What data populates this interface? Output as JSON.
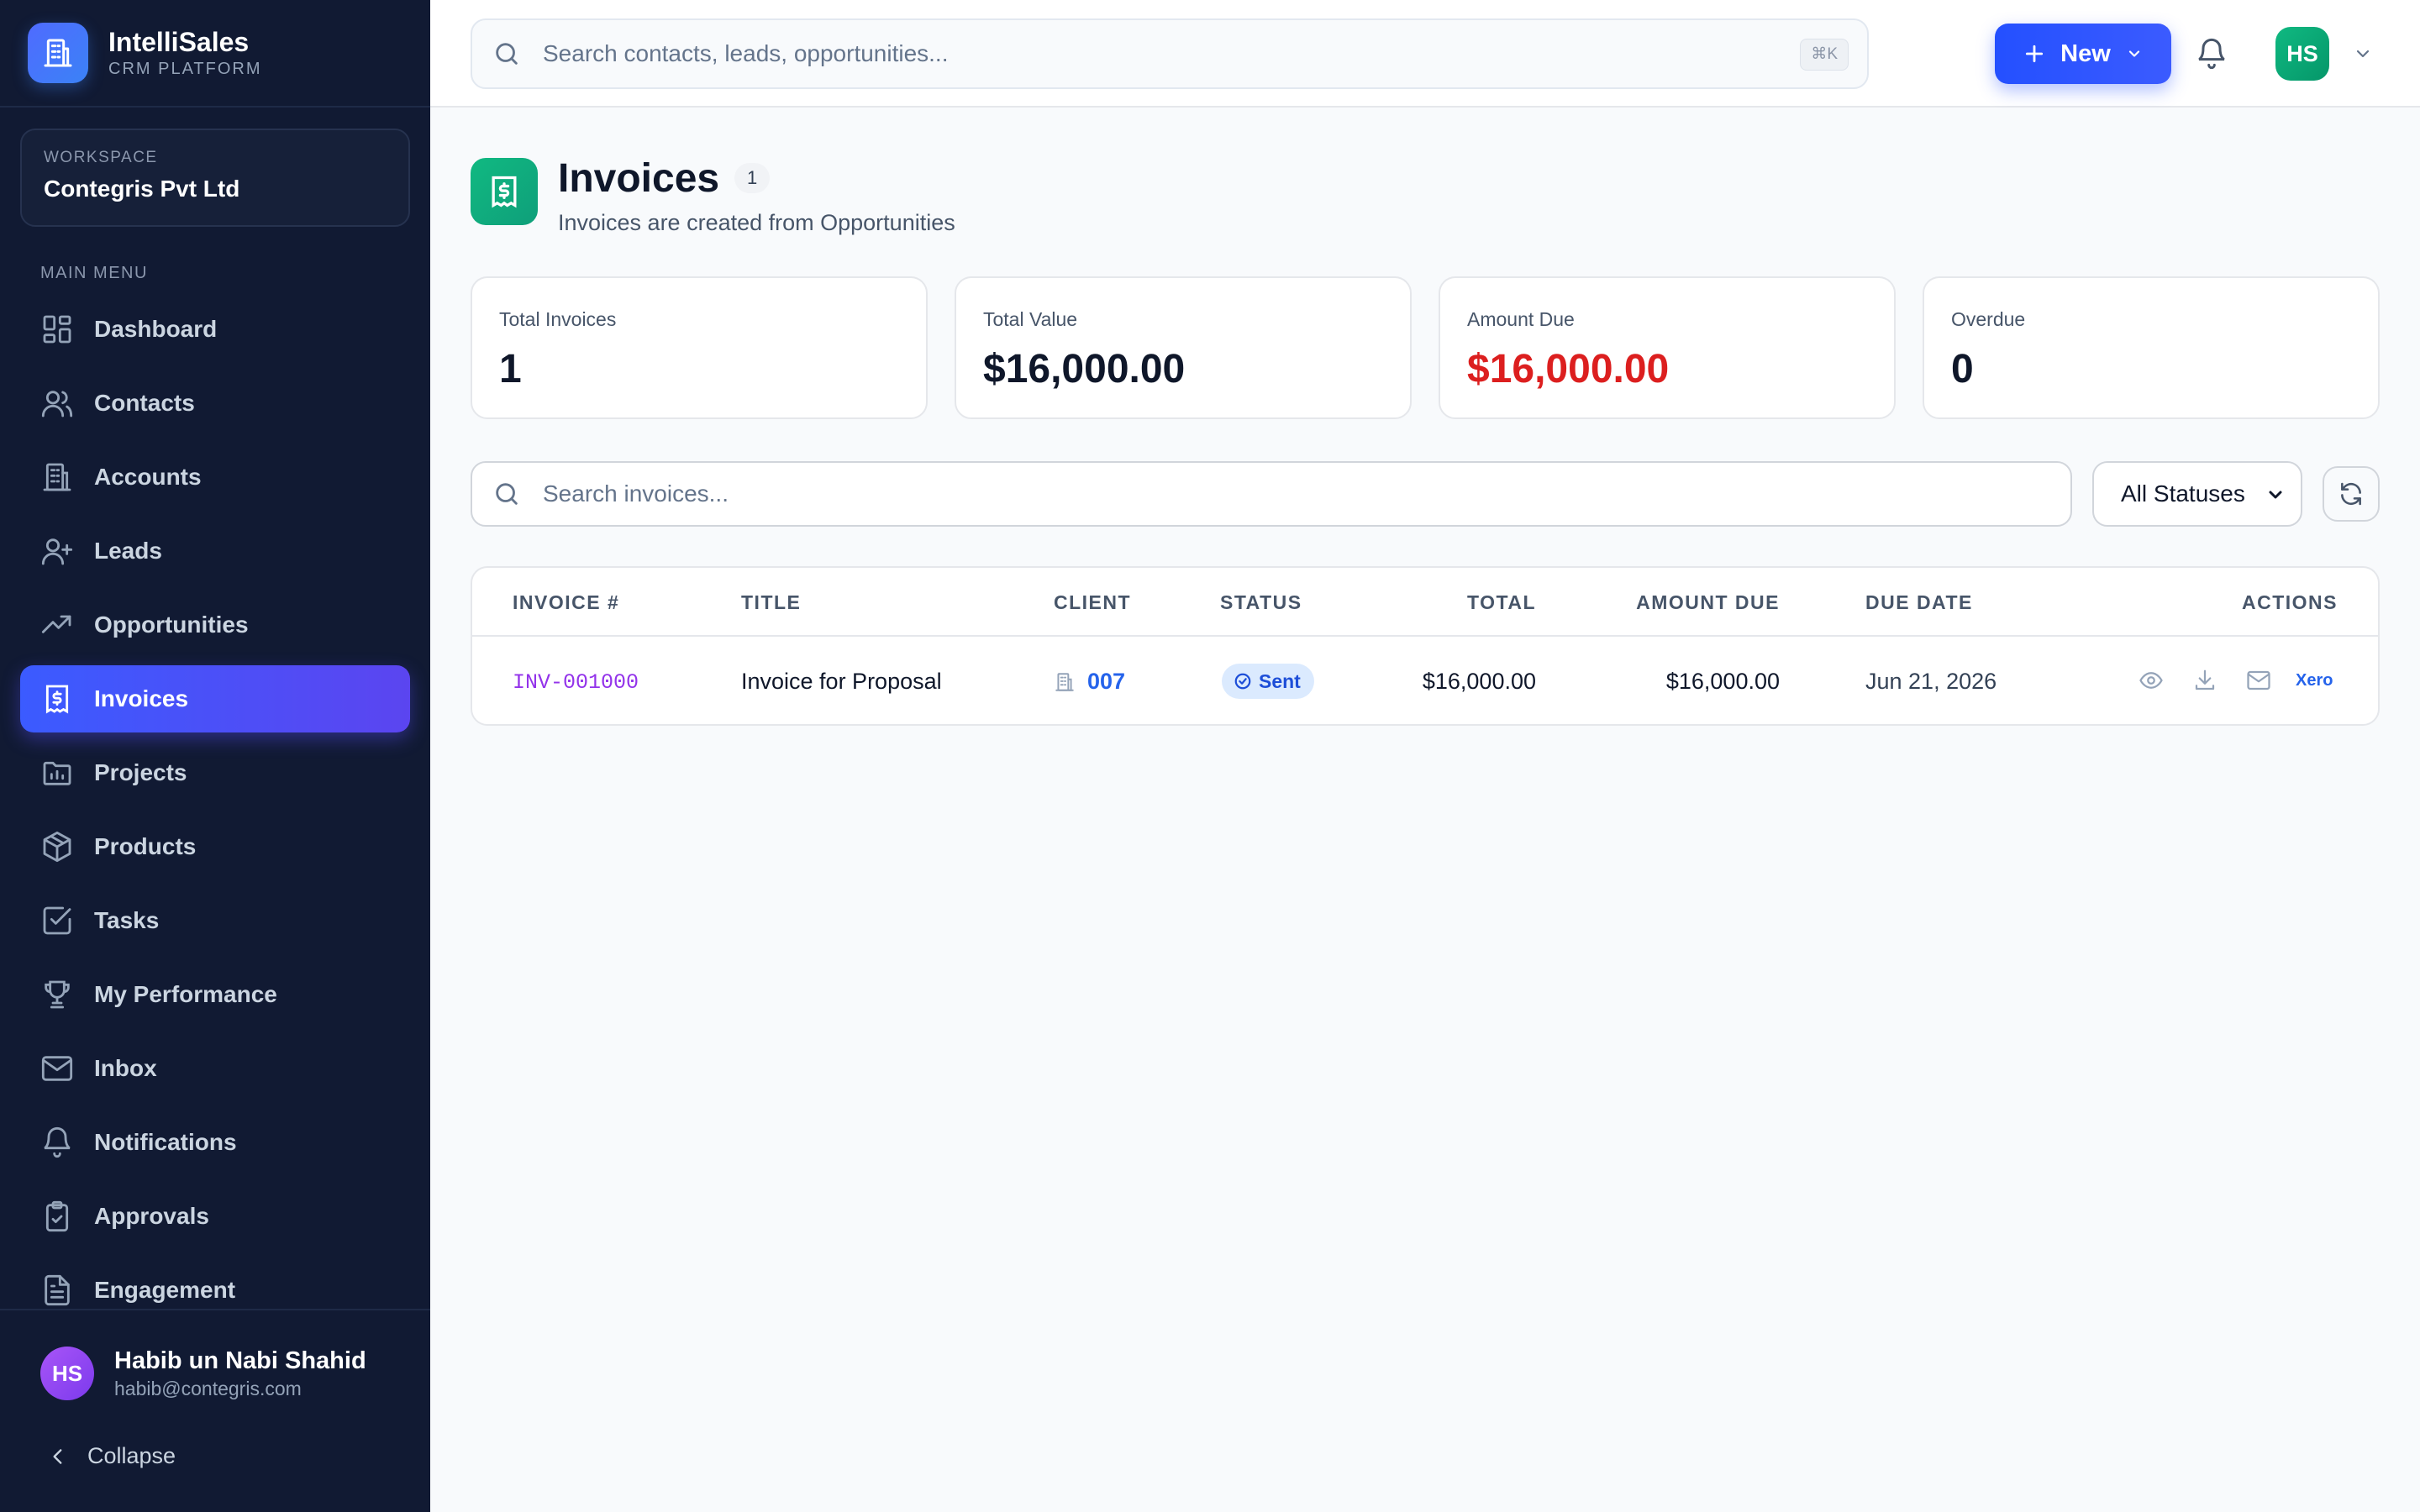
{
  "brand": {
    "name": "IntelliSales",
    "subtitle": "CRM PLATFORM"
  },
  "workspace": {
    "label": "WORKSPACE",
    "name": "Contegris Pvt Ltd"
  },
  "sidebar": {
    "menu_label": "MAIN MENU",
    "items": [
      {
        "label": "Dashboard",
        "icon": "dashboard-icon"
      },
      {
        "label": "Contacts",
        "icon": "users-icon"
      },
      {
        "label": "Accounts",
        "icon": "building-icon"
      },
      {
        "label": "Leads",
        "icon": "user-plus-icon"
      },
      {
        "label": "Opportunities",
        "icon": "trending-up-icon"
      },
      {
        "label": "Invoices",
        "icon": "receipt-icon",
        "active": true
      },
      {
        "label": "Projects",
        "icon": "folder-chart-icon"
      },
      {
        "label": "Products",
        "icon": "package-icon"
      },
      {
        "label": "Tasks",
        "icon": "check-square-icon"
      },
      {
        "label": "My Performance",
        "icon": "trophy-icon"
      },
      {
        "label": "Inbox",
        "icon": "mail-icon"
      },
      {
        "label": "Notifications",
        "icon": "bell-icon"
      },
      {
        "label": "Approvals",
        "icon": "clipboard-check-icon"
      },
      {
        "label": "Engagement",
        "icon": "file-text-icon"
      }
    ],
    "user": {
      "initials": "HS",
      "name": "Habib un Nabi Shahid",
      "email": "habib@contegris.com"
    },
    "collapse_label": "Collapse"
  },
  "topbar": {
    "search_placeholder": "Search contacts, leads, opportunities...",
    "search_shortcut": "⌘K",
    "new_label": "New",
    "avatar_initials": "HS"
  },
  "page": {
    "title": "Invoices",
    "count": "1",
    "subtitle": "Invoices are created from Opportunities"
  },
  "stats": [
    {
      "label": "Total Invoices",
      "value": "1"
    },
    {
      "label": "Total Value",
      "value": "$16,000.00"
    },
    {
      "label": "Amount Due",
      "value": "$16,000.00"
    },
    {
      "label": "Overdue",
      "value": "0"
    }
  ],
  "filters": {
    "search_placeholder": "Search invoices...",
    "status_selected": "All Statuses"
  },
  "table": {
    "columns": [
      "INVOICE #",
      "TITLE",
      "CLIENT",
      "STATUS",
      "TOTAL",
      "AMOUNT DUE",
      "DUE DATE",
      "ACTIONS"
    ],
    "rows": [
      {
        "invoice": "INV-001000",
        "title": "Invoice for Proposal",
        "client": "007",
        "status": "Sent",
        "total": "$16,000.00",
        "amount_due": "$16,000.00",
        "due_date": "Jun 21, 2026",
        "xero_label": "Xero"
      }
    ]
  },
  "colors": {
    "sidebar_bg": "#111a33",
    "accent": "#3b5bff",
    "amount_due": "#dc1f1f",
    "invoice_id": "#9333ea",
    "status_sent": "#1d4ed8"
  }
}
